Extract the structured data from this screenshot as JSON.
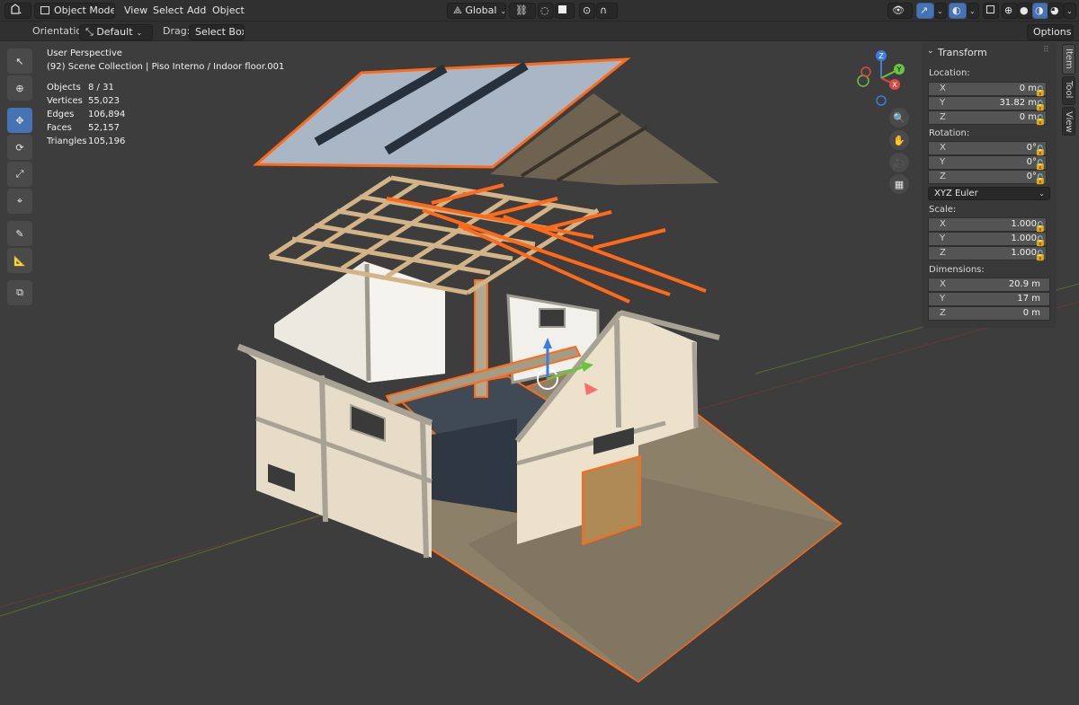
{
  "header": {
    "mode": "Object Mode",
    "menus": [
      "View",
      "Select",
      "Add",
      "Object"
    ],
    "transform_orientation": "Global",
    "accent": "#4772b3"
  },
  "tool_settings": {
    "orientation_label": "Orientation:",
    "orientation_value": "Default",
    "drag_label": "Drag:",
    "drag_value": "Select Box",
    "options_label": "Options"
  },
  "viewport": {
    "view_name": "User Perspective",
    "context": "(92) Scene Collection | Piso Interno / Indoor floor.001",
    "stats": [
      {
        "label": "Objects",
        "value": "8 / 31"
      },
      {
        "label": "Vertices",
        "value": "55,023"
      },
      {
        "label": "Edges",
        "value": "106,894"
      },
      {
        "label": "Faces",
        "value": "52,157"
      },
      {
        "label": "Triangles",
        "value": "105,196"
      }
    ],
    "selection_color": "#ff6a1a",
    "gizmo_axes": {
      "x": "X",
      "y": "Y",
      "z": "Z"
    }
  },
  "tools": [
    "select-box-icon",
    "cursor-icon",
    "move-icon",
    "rotate-icon",
    "scale-icon",
    "transform-icon",
    "annotate-icon",
    "measure-icon",
    "add-cube-icon"
  ],
  "npanel": {
    "title": "Transform",
    "location_label": "Location:",
    "location": [
      {
        "axis": "X",
        "value": "0 m"
      },
      {
        "axis": "Y",
        "value": "31.82 m"
      },
      {
        "axis": "Z",
        "value": "0 m"
      }
    ],
    "rotation_label": "Rotation:",
    "rotation": [
      {
        "axis": "X",
        "value": "0°"
      },
      {
        "axis": "Y",
        "value": "0°"
      },
      {
        "axis": "Z",
        "value": "0°"
      }
    ],
    "rotation_mode": "XYZ Euler",
    "scale_label": "Scale:",
    "scale": [
      {
        "axis": "X",
        "value": "1.000"
      },
      {
        "axis": "Y",
        "value": "1.000"
      },
      {
        "axis": "Z",
        "value": "1.000"
      }
    ],
    "dimensions_label": "Dimensions:",
    "dimensions": [
      {
        "axis": "X",
        "value": "20.9 m"
      },
      {
        "axis": "Y",
        "value": "17 m"
      },
      {
        "axis": "Z",
        "value": "0 m"
      }
    ]
  },
  "side_tabs": [
    "Item",
    "Tool",
    "View"
  ]
}
